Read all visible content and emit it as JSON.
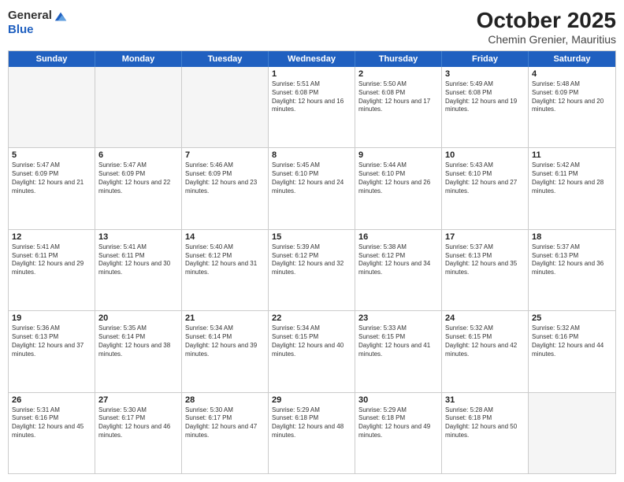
{
  "logo": {
    "general": "General",
    "blue": "Blue"
  },
  "header": {
    "month": "October 2025",
    "location": "Chemin Grenier, Mauritius"
  },
  "weekdays": [
    "Sunday",
    "Monday",
    "Tuesday",
    "Wednesday",
    "Thursday",
    "Friday",
    "Saturday"
  ],
  "rows": [
    [
      {
        "day": "",
        "empty": true
      },
      {
        "day": "",
        "empty": true
      },
      {
        "day": "",
        "empty": true
      },
      {
        "day": "1",
        "sunrise": "Sunrise: 5:51 AM",
        "sunset": "Sunset: 6:08 PM",
        "daylight": "Daylight: 12 hours and 16 minutes."
      },
      {
        "day": "2",
        "sunrise": "Sunrise: 5:50 AM",
        "sunset": "Sunset: 6:08 PM",
        "daylight": "Daylight: 12 hours and 17 minutes."
      },
      {
        "day": "3",
        "sunrise": "Sunrise: 5:49 AM",
        "sunset": "Sunset: 6:08 PM",
        "daylight": "Daylight: 12 hours and 19 minutes."
      },
      {
        "day": "4",
        "sunrise": "Sunrise: 5:48 AM",
        "sunset": "Sunset: 6:09 PM",
        "daylight": "Daylight: 12 hours and 20 minutes."
      }
    ],
    [
      {
        "day": "5",
        "sunrise": "Sunrise: 5:47 AM",
        "sunset": "Sunset: 6:09 PM",
        "daylight": "Daylight: 12 hours and 21 minutes."
      },
      {
        "day": "6",
        "sunrise": "Sunrise: 5:47 AM",
        "sunset": "Sunset: 6:09 PM",
        "daylight": "Daylight: 12 hours and 22 minutes."
      },
      {
        "day": "7",
        "sunrise": "Sunrise: 5:46 AM",
        "sunset": "Sunset: 6:09 PM",
        "daylight": "Daylight: 12 hours and 23 minutes."
      },
      {
        "day": "8",
        "sunrise": "Sunrise: 5:45 AM",
        "sunset": "Sunset: 6:10 PM",
        "daylight": "Daylight: 12 hours and 24 minutes."
      },
      {
        "day": "9",
        "sunrise": "Sunrise: 5:44 AM",
        "sunset": "Sunset: 6:10 PM",
        "daylight": "Daylight: 12 hours and 26 minutes."
      },
      {
        "day": "10",
        "sunrise": "Sunrise: 5:43 AM",
        "sunset": "Sunset: 6:10 PM",
        "daylight": "Daylight: 12 hours and 27 minutes."
      },
      {
        "day": "11",
        "sunrise": "Sunrise: 5:42 AM",
        "sunset": "Sunset: 6:11 PM",
        "daylight": "Daylight: 12 hours and 28 minutes."
      }
    ],
    [
      {
        "day": "12",
        "sunrise": "Sunrise: 5:41 AM",
        "sunset": "Sunset: 6:11 PM",
        "daylight": "Daylight: 12 hours and 29 minutes."
      },
      {
        "day": "13",
        "sunrise": "Sunrise: 5:41 AM",
        "sunset": "Sunset: 6:11 PM",
        "daylight": "Daylight: 12 hours and 30 minutes."
      },
      {
        "day": "14",
        "sunrise": "Sunrise: 5:40 AM",
        "sunset": "Sunset: 6:12 PM",
        "daylight": "Daylight: 12 hours and 31 minutes."
      },
      {
        "day": "15",
        "sunrise": "Sunrise: 5:39 AM",
        "sunset": "Sunset: 6:12 PM",
        "daylight": "Daylight: 12 hours and 32 minutes."
      },
      {
        "day": "16",
        "sunrise": "Sunrise: 5:38 AM",
        "sunset": "Sunset: 6:12 PM",
        "daylight": "Daylight: 12 hours and 34 minutes."
      },
      {
        "day": "17",
        "sunrise": "Sunrise: 5:37 AM",
        "sunset": "Sunset: 6:13 PM",
        "daylight": "Daylight: 12 hours and 35 minutes."
      },
      {
        "day": "18",
        "sunrise": "Sunrise: 5:37 AM",
        "sunset": "Sunset: 6:13 PM",
        "daylight": "Daylight: 12 hours and 36 minutes."
      }
    ],
    [
      {
        "day": "19",
        "sunrise": "Sunrise: 5:36 AM",
        "sunset": "Sunset: 6:13 PM",
        "daylight": "Daylight: 12 hours and 37 minutes."
      },
      {
        "day": "20",
        "sunrise": "Sunrise: 5:35 AM",
        "sunset": "Sunset: 6:14 PM",
        "daylight": "Daylight: 12 hours and 38 minutes."
      },
      {
        "day": "21",
        "sunrise": "Sunrise: 5:34 AM",
        "sunset": "Sunset: 6:14 PM",
        "daylight": "Daylight: 12 hours and 39 minutes."
      },
      {
        "day": "22",
        "sunrise": "Sunrise: 5:34 AM",
        "sunset": "Sunset: 6:15 PM",
        "daylight": "Daylight: 12 hours and 40 minutes."
      },
      {
        "day": "23",
        "sunrise": "Sunrise: 5:33 AM",
        "sunset": "Sunset: 6:15 PM",
        "daylight": "Daylight: 12 hours and 41 minutes."
      },
      {
        "day": "24",
        "sunrise": "Sunrise: 5:32 AM",
        "sunset": "Sunset: 6:15 PM",
        "daylight": "Daylight: 12 hours and 42 minutes."
      },
      {
        "day": "25",
        "sunrise": "Sunrise: 5:32 AM",
        "sunset": "Sunset: 6:16 PM",
        "daylight": "Daylight: 12 hours and 44 minutes."
      }
    ],
    [
      {
        "day": "26",
        "sunrise": "Sunrise: 5:31 AM",
        "sunset": "Sunset: 6:16 PM",
        "daylight": "Daylight: 12 hours and 45 minutes."
      },
      {
        "day": "27",
        "sunrise": "Sunrise: 5:30 AM",
        "sunset": "Sunset: 6:17 PM",
        "daylight": "Daylight: 12 hours and 46 minutes."
      },
      {
        "day": "28",
        "sunrise": "Sunrise: 5:30 AM",
        "sunset": "Sunset: 6:17 PM",
        "daylight": "Daylight: 12 hours and 47 minutes."
      },
      {
        "day": "29",
        "sunrise": "Sunrise: 5:29 AM",
        "sunset": "Sunset: 6:18 PM",
        "daylight": "Daylight: 12 hours and 48 minutes."
      },
      {
        "day": "30",
        "sunrise": "Sunrise: 5:29 AM",
        "sunset": "Sunset: 6:18 PM",
        "daylight": "Daylight: 12 hours and 49 minutes."
      },
      {
        "day": "31",
        "sunrise": "Sunrise: 5:28 AM",
        "sunset": "Sunset: 6:18 PM",
        "daylight": "Daylight: 12 hours and 50 minutes."
      },
      {
        "day": "",
        "empty": true
      }
    ]
  ]
}
